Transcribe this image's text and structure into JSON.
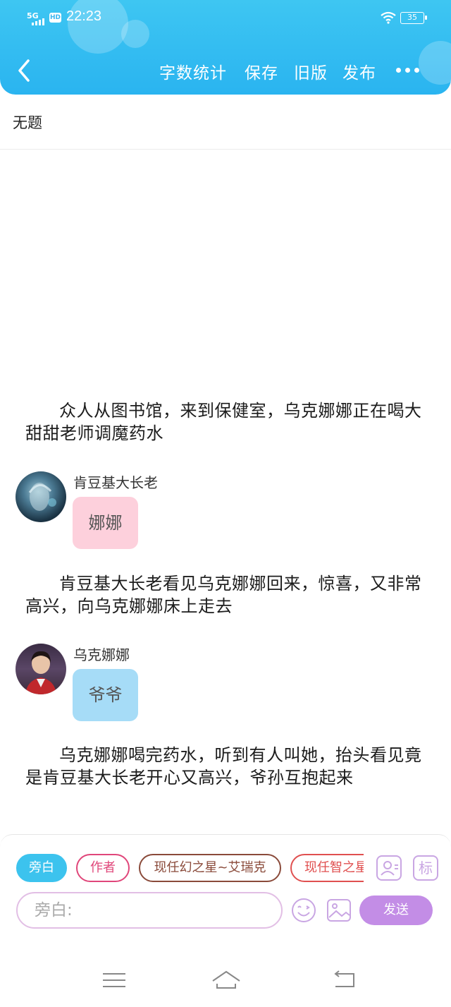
{
  "status_bar": {
    "network": "5G",
    "hd": "HD",
    "time": "22:23",
    "battery": "35"
  },
  "header": {
    "actions": {
      "word_count": "字数统计",
      "save": "保存",
      "old_version": "旧版",
      "publish": "发布"
    },
    "bg_color": "#3ec6f2"
  },
  "title": "无题",
  "story": {
    "para1": "众人从图书馆，来到保健室，乌克娜娜正在喝大甜甜老师调魔药水",
    "speaker1": {
      "name": "肯豆基大长老",
      "message": "娜娜",
      "bubble_color": "#fdd0dc"
    },
    "para2": "肯豆基大长老看见乌克娜娜回来，惊喜，又非常高兴，向乌克娜娜床上走去",
    "speaker2": {
      "name": "乌克娜娜",
      "message": "爷爷",
      "bubble_color": "#a6dcf7"
    },
    "para3": "乌克娜娜喝完药水，听到有人叫她，抬头看见竟是肯豆基大长老开心又高兴，爷孙互抱起来"
  },
  "composer": {
    "roles": {
      "narrator": "旁白",
      "author": "作者",
      "role1": "现任幻之星~艾瑞克",
      "role2": "现任智之星~"
    },
    "side_buttons": {
      "char_icon": "person-card-icon",
      "tag": "标"
    },
    "input_placeholder": "旁白:",
    "send": "发送",
    "colors": {
      "narrator": "#3cc3ee",
      "author": "#e0467a",
      "role1": "#8a4a3a",
      "role2": "#e05050",
      "send": "#c38de6"
    }
  },
  "navbar": {
    "icons": [
      "menu-icon",
      "home-icon",
      "back-icon"
    ]
  }
}
